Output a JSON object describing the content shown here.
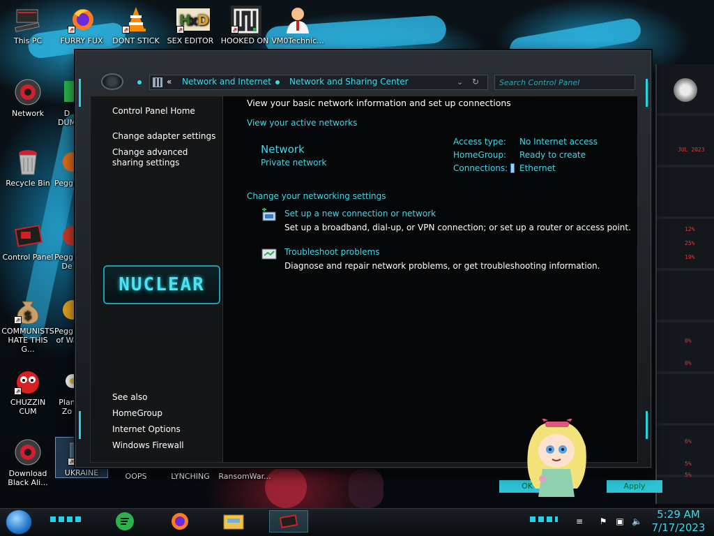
{
  "desktop": {
    "icons_top": [
      {
        "label": "This PC",
        "icon": "computer-icon"
      },
      {
        "label": "FURRY FUX",
        "icon": "firefox-icon"
      },
      {
        "label": "DONT STICK",
        "icon": "vlc-cone-icon"
      },
      {
        "label": "SEX EDITOR",
        "icon": "hxd-icon"
      },
      {
        "label": "HOOKED ON",
        "icon": "maze-icon"
      },
      {
        "label": "VM0Technic...",
        "icon": "doctor-icon"
      }
    ],
    "icons_left": [
      {
        "label": "Network",
        "icon": "network-icon"
      },
      {
        "label": "Recycle Bin",
        "icon": "recycle-bin-icon"
      },
      {
        "label": "Control Panel",
        "icon": "control-panel-icon"
      },
      {
        "label": "COMMUNISTS HATE THIS G...",
        "icon": "money-bag-icon"
      },
      {
        "label": "CHUZZIN CUM",
        "icon": "chuzzle-icon"
      },
      {
        "label": "Download Black Ali...",
        "icon": "alien-icon"
      }
    ],
    "icons_col2": [
      {
        "label": "D DUM",
        "icon": "app-icon"
      },
      {
        "label": "Peggle",
        "icon": "peggle-icon"
      },
      {
        "label": "Peggle De",
        "icon": "peggle-icon"
      },
      {
        "label": "Peggle of Wa",
        "icon": "peggle-icon"
      },
      {
        "label": "Plan Zo",
        "icon": "flower-icon"
      }
    ],
    "icons_bottom": [
      {
        "label": "UKRAINE",
        "icon": "folder-icon"
      },
      {
        "label": "OOPS",
        "icon": "app-icon"
      },
      {
        "label": "LYNCHING",
        "icon": "app-icon"
      },
      {
        "label": "RansomWar...",
        "icon": "app-icon"
      }
    ]
  },
  "window": {
    "address": {
      "chevron": "«",
      "crumb1": "Network and Internet",
      "crumb2": "Network and Sharing Center"
    },
    "search_placeholder": "Search Control Panel",
    "left_pane": {
      "home": "Control Panel Home",
      "adapter": "Change adapter settings",
      "sharing": "Change advanced sharing settings",
      "logo_text": "NUCLEAR",
      "see_also": "See also",
      "homegroup": "HomeGroup",
      "internet_options": "Internet Options",
      "firewall": "Windows Firewall"
    },
    "main": {
      "heading": "View your basic network information and set up connections",
      "active_networks": "View your active networks",
      "network_name": "Network",
      "network_type": "Private network",
      "access_type_label": "Access type:",
      "access_type_value": "No Internet access",
      "homegroup_label": "HomeGroup:",
      "homegroup_value": "Ready to create",
      "connections_label": "Connections:",
      "connections_value": "Ethernet",
      "change_settings": "Change your networking settings",
      "setup_link": "Set up a new connection or network",
      "setup_desc": "Set up a broadband, dial-up, or VPN connection; or set up a router or access point.",
      "troubleshoot_link": "Troubleshoot problems",
      "troubleshoot_desc": "Diagnose and repair network problems, or get troubleshooting information."
    }
  },
  "gadget": {
    "readings": [
      "12%",
      "25%",
      "19%",
      "0%",
      "0%",
      "6%",
      "5%",
      "5%"
    ],
    "date_text": "JUL 2023",
    "background_buttons": [
      "OK",
      "Apply"
    ]
  },
  "taskbar": {
    "pinned": [
      "spotify-icon",
      "firefox-icon",
      "file-explorer-icon",
      "control-panel-icon"
    ],
    "time": "5:29 AM",
    "date": "7/17/2023",
    "tray_icons": [
      "action-center-flag-icon",
      "network-tray-icon",
      "volume-icon"
    ]
  }
}
